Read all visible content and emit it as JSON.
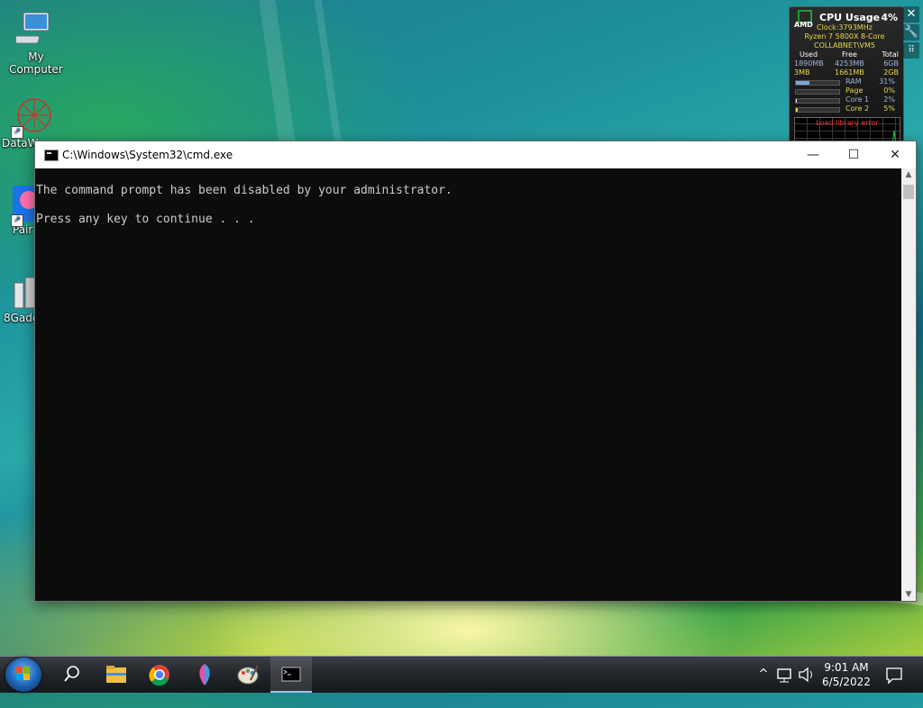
{
  "desktop": {
    "icons": [
      {
        "label": "My Computer"
      },
      {
        "label": "DataW"
      },
      {
        "label": "Pair"
      },
      {
        "label": "8Gadg"
      }
    ]
  },
  "gadget": {
    "brand": "AMD",
    "title": "CPU Usage",
    "cpu_percent": "4%",
    "clock": "Clock:3793MHz",
    "processor": "Ryzen 7 5800X 8-Core",
    "host": "COLLABNET\\VM5",
    "mem_headers": [
      "Used",
      "Free",
      "Total"
    ],
    "mem_row1": [
      "1890MB",
      "4253MB",
      "6GB"
    ],
    "mem_row2": [
      "3MB",
      "1661MB",
      "2GB"
    ],
    "meters": [
      {
        "label": "RAM",
        "value": "31%",
        "fill": 0.31
      },
      {
        "label": "Page",
        "value": "0%",
        "fill": 0.0
      },
      {
        "label": "Core 1",
        "value": "2%",
        "fill": 0.02
      },
      {
        "label": "Core 2",
        "value": "5%",
        "fill": 0.05
      }
    ],
    "graph_error": "Load library error"
  },
  "window": {
    "title": "C:\\Windows\\System32\\cmd.exe",
    "minimize": "—",
    "maximize": "☐",
    "close": "✕",
    "lines": [
      "The command prompt has been disabled by your administrator.",
      "Press any key to continue . . ."
    ]
  },
  "taskbar": {
    "tray_chevron": "^",
    "clock_time": "9:01 AM",
    "clock_date": "6/5/2022"
  }
}
